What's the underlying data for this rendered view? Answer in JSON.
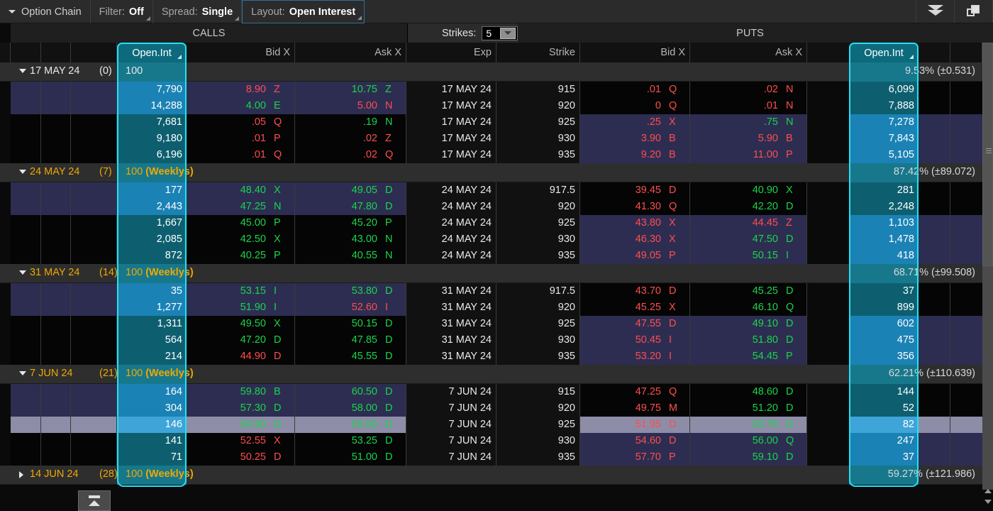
{
  "toolbar": {
    "title": "Option Chain",
    "filter_label": "Filter:",
    "filter_value": "Off",
    "spread_label": "Spread:",
    "spread_value": "Single",
    "layout_label": "Layout:",
    "layout_value": "Open Interest",
    "collapse_icon": "double-chevron-down-icon",
    "detach_icon": "detach-window-icon"
  },
  "strikes": {
    "label": "Strikes:",
    "value": "5"
  },
  "sections": {
    "calls": "CALLS",
    "puts": "PUTS"
  },
  "columns": {
    "calls_oi": "Open.Int",
    "calls_bid": "Bid X",
    "calls_ask": "Ask X",
    "exp": "Exp",
    "strike": "Strike",
    "puts_bid": "Bid X",
    "puts_ask": "Ask X",
    "puts_oi": "Open.Int"
  },
  "groups": [
    {
      "expanded": true,
      "date": "17 MAY 24",
      "dte": "(0)",
      "multiplier": "100",
      "weeklys": "",
      "iv": "9.53% (±0.531)",
      "rows": [
        {
          "c_oi": "7,790",
          "c_bid": "8.90",
          "c_bid_dir": "down",
          "c_bid_x": "Z",
          "c_ask": "10.75",
          "c_ask_dir": "up",
          "c_ask_x": "Z",
          "exp": "17 MAY 24",
          "strike": "915",
          "p_bid": ".01",
          "p_bid_dir": "down",
          "p_bid_x": "Q",
          "p_ask": ".02",
          "p_ask_dir": "down",
          "p_ask_x": "N",
          "p_oi": "6,099",
          "call_itm": true,
          "put_itm": false,
          "hover": false
        },
        {
          "c_oi": "14,288",
          "c_bid": "4.00",
          "c_bid_dir": "up",
          "c_bid_x": "E",
          "c_ask": "5.00",
          "c_ask_dir": "down",
          "c_ask_x": "N",
          "exp": "17 MAY 24",
          "strike": "920",
          "p_bid": "0",
          "p_bid_dir": "down",
          "p_bid_x": "Q",
          "p_ask": ".01",
          "p_ask_dir": "down",
          "p_ask_x": "N",
          "p_oi": "7,888",
          "call_itm": true,
          "put_itm": false,
          "hover": false
        },
        {
          "c_oi": "7,681",
          "c_bid": ".05",
          "c_bid_dir": "down",
          "c_bid_x": "Q",
          "c_ask": ".19",
          "c_ask_dir": "up",
          "c_ask_x": "N",
          "exp": "17 MAY 24",
          "strike": "925",
          "p_bid": ".25",
          "p_bid_dir": "down",
          "p_bid_x": "X",
          "p_ask": ".75",
          "p_ask_dir": "up",
          "p_ask_x": "N",
          "p_oi": "7,278",
          "call_itm": false,
          "put_itm": true,
          "hover": false
        },
        {
          "c_oi": "9,180",
          "c_bid": ".01",
          "c_bid_dir": "down",
          "c_bid_x": "P",
          "c_ask": ".02",
          "c_ask_dir": "down",
          "c_ask_x": "Z",
          "exp": "17 MAY 24",
          "strike": "930",
          "p_bid": "3.90",
          "p_bid_dir": "down",
          "p_bid_x": "B",
          "p_ask": "5.90",
          "p_ask_dir": "down",
          "p_ask_x": "B",
          "p_oi": "7,843",
          "call_itm": false,
          "put_itm": true,
          "hover": false
        },
        {
          "c_oi": "6,196",
          "c_bid": ".01",
          "c_bid_dir": "down",
          "c_bid_x": "Q",
          "c_ask": ".02",
          "c_ask_dir": "down",
          "c_ask_x": "Q",
          "exp": "17 MAY 24",
          "strike": "935",
          "p_bid": "9.20",
          "p_bid_dir": "down",
          "p_bid_x": "B",
          "p_ask": "11.00",
          "p_ask_dir": "down",
          "p_ask_x": "P",
          "p_oi": "5,105",
          "call_itm": false,
          "put_itm": true,
          "hover": false
        }
      ]
    },
    {
      "expanded": true,
      "date": "24 MAY 24",
      "dte": "(7)",
      "multiplier": "100",
      "weeklys": "(Weeklys)",
      "iv": "87.42% (±89.072)",
      "rows": [
        {
          "c_oi": "177",
          "c_bid": "48.40",
          "c_bid_dir": "up",
          "c_bid_x": "X",
          "c_ask": "49.05",
          "c_ask_dir": "up",
          "c_ask_x": "D",
          "exp": "24 MAY 24",
          "strike": "917.5",
          "p_bid": "39.45",
          "p_bid_dir": "down",
          "p_bid_x": "D",
          "p_ask": "40.90",
          "p_ask_dir": "up",
          "p_ask_x": "X",
          "p_oi": "281",
          "call_itm": true,
          "put_itm": false,
          "hover": false
        },
        {
          "c_oi": "2,443",
          "c_bid": "47.25",
          "c_bid_dir": "up",
          "c_bid_x": "N",
          "c_ask": "47.80",
          "c_ask_dir": "up",
          "c_ask_x": "D",
          "exp": "24 MAY 24",
          "strike": "920",
          "p_bid": "41.30",
          "p_bid_dir": "down",
          "p_bid_x": "Q",
          "p_ask": "42.20",
          "p_ask_dir": "up",
          "p_ask_x": "D",
          "p_oi": "2,248",
          "call_itm": true,
          "put_itm": false,
          "hover": false
        },
        {
          "c_oi": "1,667",
          "c_bid": "45.00",
          "c_bid_dir": "up",
          "c_bid_x": "P",
          "c_ask": "45.20",
          "c_ask_dir": "up",
          "c_ask_x": "P",
          "exp": "24 MAY 24",
          "strike": "925",
          "p_bid": "43.80",
          "p_bid_dir": "down",
          "p_bid_x": "X",
          "p_ask": "44.45",
          "p_ask_dir": "down",
          "p_ask_x": "Z",
          "p_oi": "1,103",
          "call_itm": false,
          "put_itm": true,
          "hover": false
        },
        {
          "c_oi": "2,085",
          "c_bid": "42.50",
          "c_bid_dir": "up",
          "c_bid_x": "X",
          "c_ask": "43.00",
          "c_ask_dir": "up",
          "c_ask_x": "N",
          "exp": "24 MAY 24",
          "strike": "930",
          "p_bid": "46.30",
          "p_bid_dir": "down",
          "p_bid_x": "X",
          "p_ask": "47.50",
          "p_ask_dir": "up",
          "p_ask_x": "D",
          "p_oi": "1,478",
          "call_itm": false,
          "put_itm": true,
          "hover": false
        },
        {
          "c_oi": "872",
          "c_bid": "40.25",
          "c_bid_dir": "up",
          "c_bid_x": "P",
          "c_ask": "40.55",
          "c_ask_dir": "up",
          "c_ask_x": "N",
          "exp": "24 MAY 24",
          "strike": "935",
          "p_bid": "49.05",
          "p_bid_dir": "down",
          "p_bid_x": "P",
          "p_ask": "50.15",
          "p_ask_dir": "up",
          "p_ask_x": "I",
          "p_oi": "418",
          "call_itm": false,
          "put_itm": true,
          "hover": false
        }
      ]
    },
    {
      "expanded": true,
      "date": "31 MAY 24",
      "dte": "(14)",
      "multiplier": "100",
      "weeklys": "(Weeklys)",
      "iv": "68.71% (±99.508)",
      "rows": [
        {
          "c_oi": "35",
          "c_bid": "53.15",
          "c_bid_dir": "up",
          "c_bid_x": "I",
          "c_ask": "53.80",
          "c_ask_dir": "up",
          "c_ask_x": "D",
          "exp": "31 MAY 24",
          "strike": "917.5",
          "p_bid": "43.70",
          "p_bid_dir": "down",
          "p_bid_x": "D",
          "p_ask": "45.25",
          "p_ask_dir": "up",
          "p_ask_x": "D",
          "p_oi": "37",
          "call_itm": true,
          "put_itm": false,
          "hover": false
        },
        {
          "c_oi": "1,277",
          "c_bid": "51.90",
          "c_bid_dir": "up",
          "c_bid_x": "I",
          "c_ask": "52.60",
          "c_ask_dir": "down",
          "c_ask_x": "I",
          "exp": "31 MAY 24",
          "strike": "920",
          "p_bid": "45.25",
          "p_bid_dir": "down",
          "p_bid_x": "X",
          "p_ask": "46.10",
          "p_ask_dir": "up",
          "p_ask_x": "Q",
          "p_oi": "899",
          "call_itm": true,
          "put_itm": false,
          "hover": false
        },
        {
          "c_oi": "1,311",
          "c_bid": "49.50",
          "c_bid_dir": "up",
          "c_bid_x": "X",
          "c_ask": "50.15",
          "c_ask_dir": "up",
          "c_ask_x": "D",
          "exp": "31 MAY 24",
          "strike": "925",
          "p_bid": "47.55",
          "p_bid_dir": "down",
          "p_bid_x": "D",
          "p_ask": "49.10",
          "p_ask_dir": "up",
          "p_ask_x": "D",
          "p_oi": "602",
          "call_itm": false,
          "put_itm": true,
          "hover": false
        },
        {
          "c_oi": "564",
          "c_bid": "47.20",
          "c_bid_dir": "up",
          "c_bid_x": "D",
          "c_ask": "47.85",
          "c_ask_dir": "up",
          "c_ask_x": "D",
          "exp": "31 MAY 24",
          "strike": "930",
          "p_bid": "50.45",
          "p_bid_dir": "down",
          "p_bid_x": "I",
          "p_ask": "51.80",
          "p_ask_dir": "up",
          "p_ask_x": "D",
          "p_oi": "475",
          "call_itm": false,
          "put_itm": true,
          "hover": false
        },
        {
          "c_oi": "214",
          "c_bid": "44.90",
          "c_bid_dir": "down",
          "c_bid_x": "D",
          "c_ask": "45.55",
          "c_ask_dir": "up",
          "c_ask_x": "D",
          "exp": "31 MAY 24",
          "strike": "935",
          "p_bid": "53.20",
          "p_bid_dir": "down",
          "p_bid_x": "I",
          "p_ask": "54.45",
          "p_ask_dir": "up",
          "p_ask_x": "P",
          "p_oi": "356",
          "call_itm": false,
          "put_itm": true,
          "hover": false
        }
      ]
    },
    {
      "expanded": true,
      "date": "7 JUN 24",
      "dte": "(21)",
      "multiplier": "100",
      "weeklys": "(Weeklys)",
      "iv": "62.21% (±110.639)",
      "rows": [
        {
          "c_oi": "164",
          "c_bid": "59.80",
          "c_bid_dir": "up",
          "c_bid_x": "B",
          "c_ask": "60.50",
          "c_ask_dir": "up",
          "c_ask_x": "D",
          "exp": "7 JUN 24",
          "strike": "915",
          "p_bid": "47.25",
          "p_bid_dir": "down",
          "p_bid_x": "Q",
          "p_ask": "48.60",
          "p_ask_dir": "up",
          "p_ask_x": "D",
          "p_oi": "144",
          "call_itm": true,
          "put_itm": false,
          "hover": false
        },
        {
          "c_oi": "304",
          "c_bid": "57.30",
          "c_bid_dir": "up",
          "c_bid_x": "D",
          "c_ask": "58.00",
          "c_ask_dir": "up",
          "c_ask_x": "D",
          "exp": "7 JUN 24",
          "strike": "920",
          "p_bid": "49.75",
          "p_bid_dir": "down",
          "p_bid_x": "M",
          "p_ask": "51.20",
          "p_ask_dir": "up",
          "p_ask_x": "D",
          "p_oi": "52",
          "call_itm": true,
          "put_itm": false,
          "hover": false
        },
        {
          "c_oi": "146",
          "c_bid": "54.90",
          "c_bid_dir": "up",
          "c_bid_x": "D",
          "c_ask": "55.60",
          "c_ask_dir": "up",
          "c_ask_x": "D",
          "exp": "7 JUN 24",
          "strike": "925",
          "p_bid": "51.95",
          "p_bid_dir": "down",
          "p_bid_x": "D",
          "p_ask": "53.75",
          "p_ask_dir": "up",
          "p_ask_x": "D",
          "p_oi": "82",
          "call_itm": false,
          "put_itm": true,
          "hover": true
        },
        {
          "c_oi": "141",
          "c_bid": "52.55",
          "c_bid_dir": "down",
          "c_bid_x": "X",
          "c_ask": "53.25",
          "c_ask_dir": "up",
          "c_ask_x": "D",
          "exp": "7 JUN 24",
          "strike": "930",
          "p_bid": "54.60",
          "p_bid_dir": "down",
          "p_bid_x": "D",
          "p_ask": "56.00",
          "p_ask_dir": "up",
          "p_ask_x": "Q",
          "p_oi": "247",
          "call_itm": false,
          "put_itm": true,
          "hover": false
        },
        {
          "c_oi": "71",
          "c_bid": "50.25",
          "c_bid_dir": "down",
          "c_bid_x": "D",
          "c_ask": "51.00",
          "c_ask_dir": "up",
          "c_ask_x": "D",
          "exp": "7 JUN 24",
          "strike": "935",
          "p_bid": "57.70",
          "p_bid_dir": "down",
          "p_bid_x": "P",
          "p_ask": "59.10",
          "p_ask_dir": "up",
          "p_ask_x": "D",
          "p_oi": "37",
          "call_itm": false,
          "put_itm": true,
          "hover": false
        }
      ]
    },
    {
      "expanded": false,
      "date": "14 JUN 24",
      "dte": "(28)",
      "multiplier": "100",
      "weeklys": "(Weeklys)",
      "iv": "59.27% (±121.986)",
      "rows": []
    }
  ],
  "colors": {
    "accent_cyan": "#25e0f5",
    "oi_band": "#17788c",
    "itm_blue": "#2d2d52",
    "up_green": "#19d54a",
    "down_red": "#ff4d4d",
    "group_gold": "#f0a800"
  }
}
